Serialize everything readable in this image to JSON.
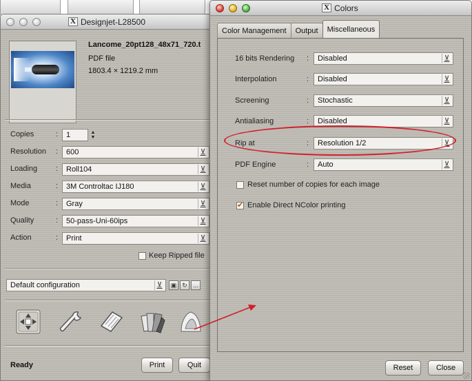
{
  "background_tabs": [
    "",
    "",
    ""
  ],
  "designjet": {
    "title": "Designjet-L28500",
    "x11_badge": "X",
    "file": {
      "name": "Lancome_20pt128_48x71_720.t",
      "type": "PDF file",
      "size": "1803.4 × 1219.2 mm"
    },
    "props": [
      {
        "key": "copies",
        "label": "Copies",
        "value": "1"
      },
      {
        "key": "resolution",
        "label": "Resolution",
        "value": "600"
      },
      {
        "key": "loading",
        "label": "Loading",
        "value": "Roll104"
      },
      {
        "key": "media",
        "label": "Media",
        "value": "3M Controltac IJ180"
      },
      {
        "key": "mode",
        "label": "Mode",
        "value": "Gray"
      },
      {
        "key": "quality",
        "label": "Quality",
        "value": "50-pass-Uni-60ips"
      },
      {
        "key": "action",
        "label": "Action",
        "value": "Print"
      }
    ],
    "colon": ":",
    "keep_ripped": {
      "label": "Keep Ripped file",
      "checked": false
    },
    "config": {
      "value": "Default configuration",
      "more": "..."
    },
    "tools": [
      "move-icon",
      "wrench-icon",
      "paper-icon",
      "color-swatches-icon",
      "colors-icon"
    ],
    "status": "Ready",
    "print_label": "Print",
    "quit_label": "Quit"
  },
  "colors": {
    "title": "Colors",
    "x11_badge": "X",
    "tabs": [
      "Color Management",
      "Output",
      "Miscellaneous"
    ],
    "active_tab": "Miscellaneous",
    "rows": [
      {
        "key": "bits16",
        "label": "16 bits Rendering",
        "value": "Disabled"
      },
      {
        "key": "interp",
        "label": "Interpolation",
        "value": "Disabled"
      },
      {
        "key": "screening",
        "label": "Screening",
        "value": "Stochastic"
      },
      {
        "key": "antialias",
        "label": "Antialiasing",
        "value": "Disabled"
      },
      {
        "key": "ripat",
        "label": "Rip at",
        "value": "Resolution 1/2"
      },
      {
        "key": "pdfengine",
        "label": "PDF Engine",
        "value": "Auto"
      }
    ],
    "colon": ":",
    "reset_copies": {
      "label": "Reset number of copies for each image",
      "checked": false
    },
    "direct_ncolor": {
      "label": "Enable Direct NColor printing",
      "checked": true
    },
    "reset_label": "Reset",
    "close_label": "Close"
  },
  "annotation_color": "#d11e2a"
}
